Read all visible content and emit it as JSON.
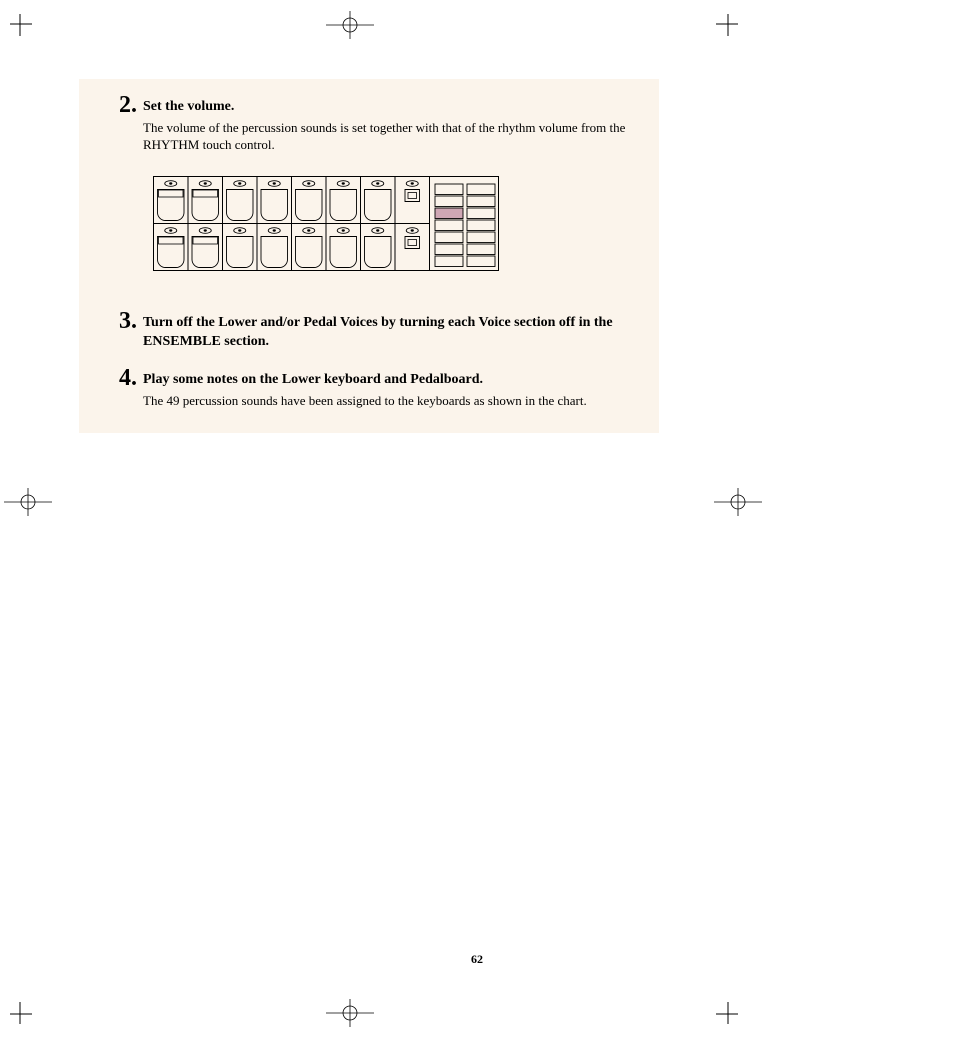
{
  "page_number": "62",
  "steps": [
    {
      "num": "2.",
      "head": "Set the volume.",
      "desc": "The volume of the percussion sounds is set together with that of the rhythm volume from the RHYTHM touch control."
    },
    {
      "num": "3.",
      "head": "Turn off the Lower and/or Pedal Voices by turning each Voice section off in the ENSEMBLE section.",
      "desc": ""
    },
    {
      "num": "4.",
      "head": "Play some notes on the Lower keyboard and Pedalboard.",
      "desc": "The 49 percussion sounds have been assigned to the keyboards as shown in the chart."
    }
  ],
  "diagram": {
    "rows": 2,
    "buttons_per_row": 8,
    "slider_segments": 7,
    "highlighted_segment_index": 2
  }
}
